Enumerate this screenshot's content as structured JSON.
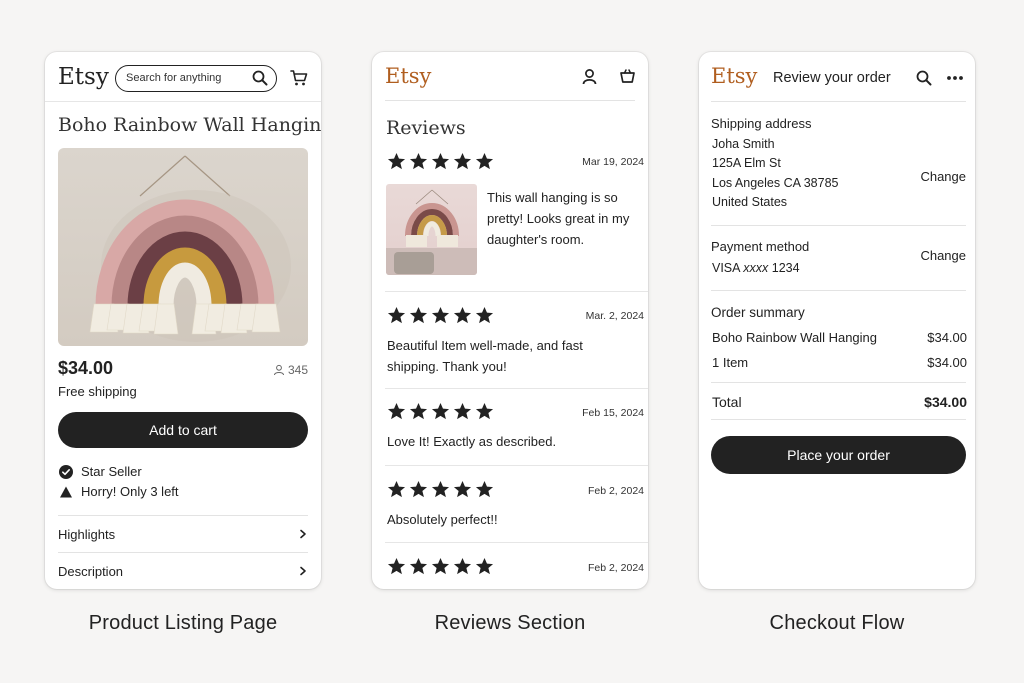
{
  "colors": {
    "etsy_orange": "#b05e1f",
    "button_dark": "#222222",
    "background": "#f6f5f4"
  },
  "product_page": {
    "logo": "Etsy",
    "search_placeholder": "Search for anything",
    "title": "Boho Rainbow Wall Hanging",
    "price": "$34.00",
    "favorites_count": "345",
    "shipping": "Free shipping",
    "add_to_cart": "Add to cart",
    "badges": [
      "Star Seller",
      "Horry! Only 3 left"
    ],
    "accordions": [
      "Highlights",
      "Description"
    ],
    "caption": "Product Listing Page"
  },
  "reviews_page": {
    "logo": "Etsy",
    "title": "Reviews",
    "reviews": [
      {
        "rating": 5,
        "date": "Mar 19, 2024",
        "text": "This wall hanging is so pretty! Looks great in my daughter's room."
      },
      {
        "rating": 5,
        "date": "Mar. 2, 2024",
        "text": "Beautiful Item  well-made, and fast shipping. Thank you!"
      },
      {
        "rating": 5,
        "date": "Feb 15, 2024",
        "text": "Love It! Exactly as described."
      },
      {
        "rating": 5,
        "date": "Feb 2, 2024",
        "text": "Absolutely perfect!!"
      },
      {
        "rating": 5,
        "date": "Feb 2, 2024",
        "text": ""
      }
    ],
    "caption": "Reviews Section"
  },
  "checkout_page": {
    "logo": "Etsy",
    "title": "Review your order",
    "shipping_label": "Shipping address",
    "address_lines": [
      "Joha Smith",
      "125A Elm St",
      "Los Angeles CA 38785",
      "United States"
    ],
    "change_label": "Change",
    "payment_label": "Payment method",
    "payment_card_brand": "VISA",
    "payment_mask": "xxxx",
    "payment_last4": "1234",
    "summary_label": "Order summary",
    "summary_rows": [
      {
        "label": "Boho Rainbow  Wall Hanging",
        "value": "$34.00"
      },
      {
        "label": "1 Item",
        "value": "$34.00"
      }
    ],
    "total_label": "Total",
    "total_value": "$34.00",
    "place_order": "Place your order",
    "caption": "Checkout Flow"
  }
}
